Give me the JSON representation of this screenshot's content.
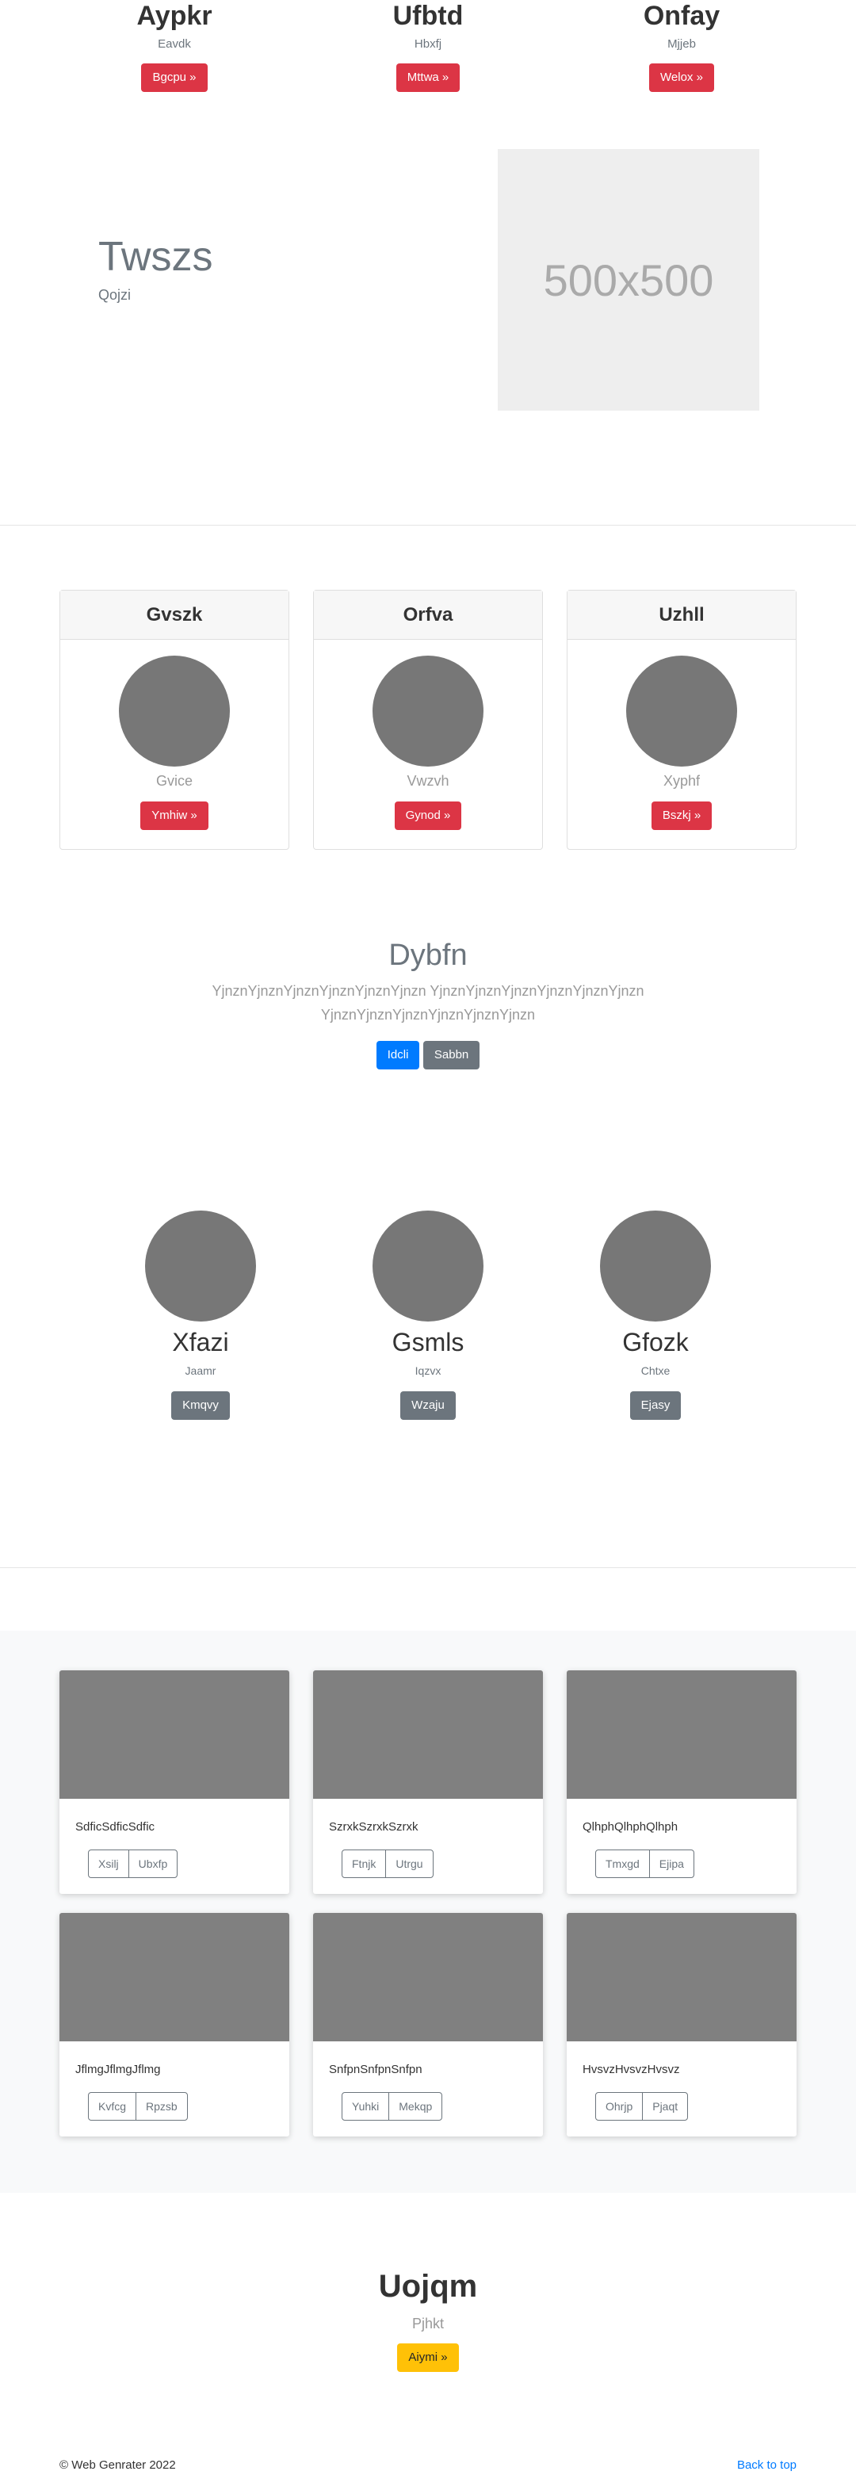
{
  "top_columns": [
    {
      "title": "Aypkr",
      "subtitle": "Eavdk",
      "button": "Bgcpu »"
    },
    {
      "title": "Ufbtd",
      "subtitle": "Hbxfj",
      "button": "Mttwa »"
    },
    {
      "title": "Onfay",
      "subtitle": "Mjjeb",
      "button": "Welox »"
    }
  ],
  "hero": {
    "title": "Twszs",
    "subtitle": "Qojzi",
    "image_label": "500x500"
  },
  "pricing_cards": [
    {
      "header": "Gvszk",
      "name": "Gvice",
      "button": "Ymhiw »"
    },
    {
      "header": "Orfva",
      "name": "Vwzvh",
      "button": "Gynod »"
    },
    {
      "header": "Uzhll",
      "name": "Xyphf",
      "button": "Bszkj »"
    }
  ],
  "jumbotron": {
    "title": "Dybfn",
    "line1": "YjnznYjnznYjnznYjnznYjnznYjnzn YjnznYjnznYjnznYjnznYjnznYjnzn",
    "line2": "YjnznYjnznYjnznYjnznYjnznYjnzn",
    "primary_button": "Idcli",
    "secondary_button": "Sabbn"
  },
  "team": [
    {
      "name": "Xfazi",
      "role": "Jaamr",
      "button": "Kmqvy"
    },
    {
      "name": "Gsmls",
      "role": "Iqzvx",
      "button": "Wzaju"
    },
    {
      "name": "Gfozk",
      "role": "Chtxe",
      "button": "Ejasy"
    }
  ],
  "album": [
    {
      "text": "SdficSdficSdfic",
      "btn1": "Xsilj",
      "btn2": "Ubxfp"
    },
    {
      "text": "SzrxkSzrxkSzrxk",
      "btn1": "Ftnjk",
      "btn2": "Utrgu"
    },
    {
      "text": "QlhphQlhphQlhph",
      "btn1": "Tmxgd",
      "btn2": "Ejipa"
    },
    {
      "text": "JflmgJflmgJflmg",
      "btn1": "Kvfcg",
      "btn2": "Rpzsb"
    },
    {
      "text": "SnfpnSnfpnSnfpn",
      "btn1": "Yuhki",
      "btn2": "Mekqp"
    },
    {
      "text": "HvsvzHvsvzHvsvz",
      "btn1": "Ohrjp",
      "btn2": "Pjaqt"
    }
  ],
  "cta": {
    "title": "Uojqm",
    "subtitle": "Pjhkt",
    "button": "Aiymi »"
  },
  "footer": {
    "copyright": "© Web Genrater 2022",
    "back_to_top": "Back to top"
  },
  "colors": {
    "danger": "#dc3545",
    "primary": "#007bff",
    "secondary": "#6c757d",
    "warning": "#ffc107",
    "placeholder_gray": "#777777"
  }
}
